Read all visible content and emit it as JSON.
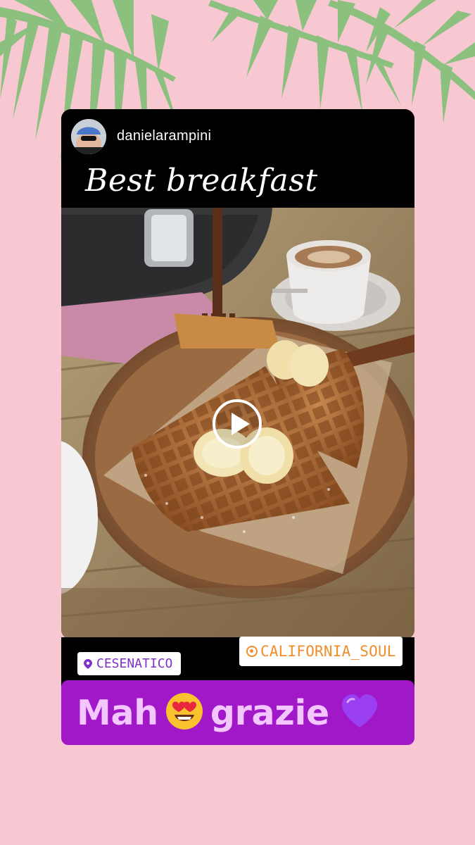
{
  "story": {
    "username": "danielarampini",
    "caption": "Best breakfast",
    "location_label": "CESENATICO",
    "mention_label": "CALIFORNIA_SOUL",
    "message": {
      "part1": "Mah",
      "part2": "grazie"
    }
  },
  "icons": {
    "play": "play-icon",
    "location": "location-pin-icon",
    "mention": "at-sign-icon",
    "emoji_1": "heart-eyes-emoji",
    "emoji_2": "purple-heart-emoji"
  },
  "colors": {
    "background": "#f7c8d2",
    "palm_leaf": "#8cc07e",
    "message_bar": "#a018c8",
    "message_text": "#f4c6ff",
    "mention_text": "#f08d2a",
    "location_text": "#7f31c8"
  }
}
